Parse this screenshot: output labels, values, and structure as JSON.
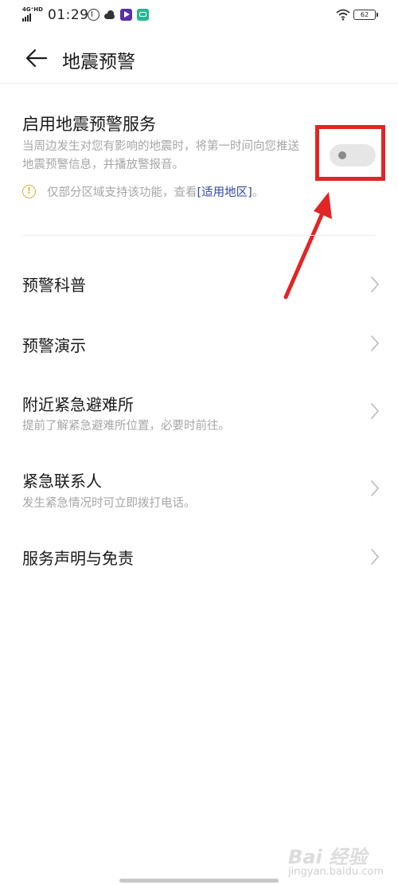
{
  "status_bar": {
    "network": "4G⁺HD",
    "time": "01:29",
    "battery": "62"
  },
  "header": {
    "title": "地震预警"
  },
  "alert_setting": {
    "title": "启用地震预警服务",
    "description": "当周边发生对您有影响的地震时，将第一时间向您推送地震预警信息，并播放警报音。",
    "enabled": false,
    "notice_prefix": "仅部分区域支持该功能，查看",
    "notice_link": "[适用地区]",
    "notice_suffix": "。"
  },
  "menu": {
    "items": [
      {
        "title": "预警科普"
      },
      {
        "title": "预警演示"
      },
      {
        "title": "附近紧急避难所",
        "subtitle": "提前了解紧急避难所位置，必要时前往。"
      },
      {
        "title": "紧急联系人",
        "subtitle": "发生紧急情况时可立即拨打电话。"
      },
      {
        "title": "服务声明与免责"
      }
    ]
  },
  "watermark": {
    "brand": "Bai 经验",
    "url": "jingyan.baidu.com"
  },
  "colors": {
    "annotation": "#e22525",
    "link": "#2c46a6",
    "warning": "#e0b03c",
    "secondary_text": "#a6a6a6"
  },
  "icons": [
    "back-arrow-icon",
    "warning-icon",
    "chevron-right-icon",
    "wifi-icon",
    "battery-icon"
  ]
}
